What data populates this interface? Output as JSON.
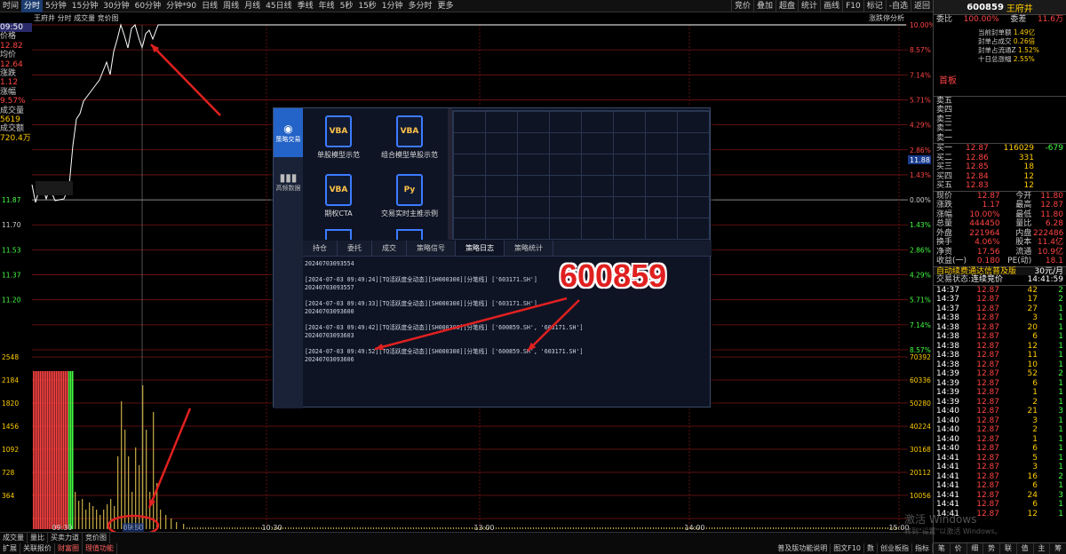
{
  "topbar": {
    "left_items": [
      "时间",
      "分时",
      "5分钟",
      "15分钟",
      "30分钟",
      "60分钟",
      "分钟*90",
      "日线",
      "周线",
      "月线",
      "45日线",
      "季线",
      "年线",
      "5秒",
      "15秒",
      "1分钟",
      "多分时",
      "更多"
    ],
    "right_items": [
      "竞价",
      "叠加",
      "超盘",
      "统计",
      "画线",
      "F10",
      "标记",
      "-自选",
      "返回"
    ],
    "sub_left": [
      "王府井",
      "分时",
      "成交量",
      "竞价图"
    ],
    "sub_right": "涨跌停分析"
  },
  "stock": {
    "code": "600859",
    "name": "王府井"
  },
  "left_info": {
    "time_label": "09:50",
    "price_label": "价格",
    "price": "12.82",
    "avg_label": "均价",
    "avg": "12.64",
    "chg_label": "涨跌",
    "chg": "1.12",
    "pct_label": "涨幅",
    "pct": "9.57%",
    "vol_label": "成交量",
    "vol": "5619",
    "amt_label": "成交额",
    "amt": "720.4万"
  },
  "price_axis_left": [
    "11.87",
    "11.70",
    "11.53",
    "11.37",
    "11.20"
  ],
  "pct_axis_right": [
    "10.00%",
    "8.57%",
    "7.14%",
    "5.71%",
    "4.29%",
    "2.86%",
    "1.43%",
    "0.00%",
    "1.43%",
    "2.86%",
    "4.29%",
    "5.71%",
    "7.14%",
    "8.57%"
  ],
  "vol_axis_left": [
    "2548",
    "2184",
    "1820",
    "1456",
    "1092",
    "728",
    "364"
  ],
  "vol_axis_right": [
    "70392",
    "60336",
    "50280",
    "40224",
    "30168",
    "20112",
    "10056"
  ],
  "x_axis": [
    "09:30",
    "09:50",
    "10:30",
    "13:00",
    "14:00",
    "15:00"
  ],
  "current_price_tag": "11.88",
  "popup": {
    "side": [
      "策略交易",
      "高频数据"
    ],
    "tiles": [
      {
        "icon": "VBA",
        "label": "单股模型示范"
      },
      {
        "icon": "VBA",
        "label": "组合模型单股示范"
      },
      {
        "icon": "VBA",
        "label": "期权CTA"
      },
      {
        "icon": "Py",
        "label": "交易实时主推示例"
      }
    ],
    "tabs": [
      "持仓",
      "委托",
      "成交",
      "策略信号",
      "策略日志",
      "策略统计"
    ],
    "active_tab": "策略日志",
    "log": [
      {
        "a": "",
        "b": "20240703093554"
      },
      {
        "a": "[2024-07-03 09:49:24][TQ活跃度全动态][SH000300][分笔线] ['603171.SH']",
        "b": "20240703093557"
      },
      {
        "a": "[2024-07-03 09:49:33][TQ活跃度全动态][SH000300][分笔线] ['603171.SH']",
        "b": "20240703093600"
      },
      {
        "a": "[2024-07-03 09:49:42][TQ活跃度全动态][SH000300][分笔线] ['600859.SH', '603171.SH']",
        "b": "20240703093603"
      },
      {
        "a": "[2024-07-03 09:49:52][TQ活跃度全动态][SH000300][分笔线] ['600859.SH', '603171.SH']",
        "b": "20240703093606"
      }
    ]
  },
  "annotation_text": "600859",
  "right_panel": {
    "ratio_label": "委比",
    "ratio": "100.00%",
    "ratio_label2": "委差",
    "ratio_diff": "11.6万",
    "seal": [
      [
        "当前封单额",
        "1.49亿"
      ],
      [
        "封单占成交",
        "0.26倍"
      ],
      [
        "封单占流通Z",
        "1.52%"
      ],
      [
        "十日总涨幅",
        "2.55%"
      ]
    ],
    "board": "首板",
    "asks": [
      [
        "卖五",
        "",
        ""
      ],
      [
        "卖四",
        "",
        ""
      ],
      [
        "卖三",
        "",
        ""
      ],
      [
        "卖二",
        "",
        ""
      ],
      [
        "卖一",
        "",
        ""
      ]
    ],
    "bids": [
      [
        "买一",
        "12.87",
        "116029",
        "-679"
      ],
      [
        "买二",
        "12.86",
        "331",
        ""
      ],
      [
        "买三",
        "12.85",
        "18",
        ""
      ],
      [
        "买四",
        "12.84",
        "12",
        ""
      ],
      [
        "买五",
        "12.83",
        "12",
        ""
      ]
    ],
    "stats": [
      [
        "现价",
        "12.87",
        "今开",
        "11.80"
      ],
      [
        "涨跌",
        "1.17",
        "最高",
        "12.87"
      ],
      [
        "涨幅",
        "10.00%",
        "最低",
        "11.80"
      ],
      [
        "总量",
        "444450",
        "量比",
        "6.28"
      ],
      [
        "外盘",
        "221964",
        "内盘",
        "222486"
      ],
      [
        "换手",
        "4.06%",
        "股本",
        "11.4亿"
      ],
      [
        "净资",
        "17.56",
        "流通",
        "10.9亿"
      ],
      [
        "收益(一)",
        "0.180",
        "PE(动)",
        "18.1"
      ]
    ],
    "notice": "自动续费通达信普及版",
    "notice_price": "30元/月",
    "state_label": "交易状态:",
    "state": "连续竞价",
    "state_time": "14:41:59",
    "ticks": [
      [
        "14:37",
        "12.87",
        "42",
        "2"
      ],
      [
        "14:37",
        "12.87",
        "17",
        "2"
      ],
      [
        "14:37",
        "12.87",
        "27",
        "1"
      ],
      [
        "14:38",
        "12.87",
        "3",
        "1"
      ],
      [
        "14:38",
        "12.87",
        "20",
        "1"
      ],
      [
        "14:38",
        "12.87",
        "6",
        "1"
      ],
      [
        "14:38",
        "12.87",
        "12",
        "1"
      ],
      [
        "14:38",
        "12.87",
        "11",
        "1"
      ],
      [
        "14:38",
        "12.87",
        "10",
        "1"
      ],
      [
        "14:39",
        "12.87",
        "52",
        "2"
      ],
      [
        "14:39",
        "12.87",
        "6",
        "1"
      ],
      [
        "14:39",
        "12.87",
        "1",
        "1"
      ],
      [
        "14:39",
        "12.87",
        "2",
        "1"
      ],
      [
        "14:40",
        "12.87",
        "21",
        "3"
      ],
      [
        "14:40",
        "12.87",
        "3",
        "1"
      ],
      [
        "14:40",
        "12.87",
        "2",
        "1"
      ],
      [
        "14:40",
        "12.87",
        "1",
        "1"
      ],
      [
        "14:40",
        "12.87",
        "6",
        "1"
      ],
      [
        "14:41",
        "12.87",
        "5",
        "1"
      ],
      [
        "14:41",
        "12.87",
        "3",
        "1"
      ],
      [
        "14:41",
        "12.87",
        "16",
        "2"
      ],
      [
        "14:41",
        "12.87",
        "6",
        "1"
      ],
      [
        "14:41",
        "12.87",
        "24",
        "3"
      ],
      [
        "14:41",
        "12.87",
        "6",
        "1"
      ],
      [
        "14:41",
        "12.87",
        "12",
        "1"
      ]
    ],
    "bottom_tabs": [
      "笔",
      "价",
      "细",
      "势",
      "联",
      "值",
      "主",
      "筹"
    ]
  },
  "bottombar": {
    "row1": [
      "成交量",
      "量比",
      "买卖力道",
      "竞价图"
    ],
    "row2": [
      "扩展",
      "关联报价",
      "财富圈",
      "理值功能"
    ],
    "right": [
      "普及版功能说明",
      "图文F10",
      "数",
      "创业板指",
      "指标"
    ]
  },
  "watermark": [
    "激活 Windows",
    "转到\"设置\"以激活 Windows。"
  ],
  "colors": {
    "up": "#ff4444",
    "down": "#44ff44",
    "grid": "#8b1a1a",
    "accent": "#ffcc00",
    "ring": "#e02020"
  }
}
